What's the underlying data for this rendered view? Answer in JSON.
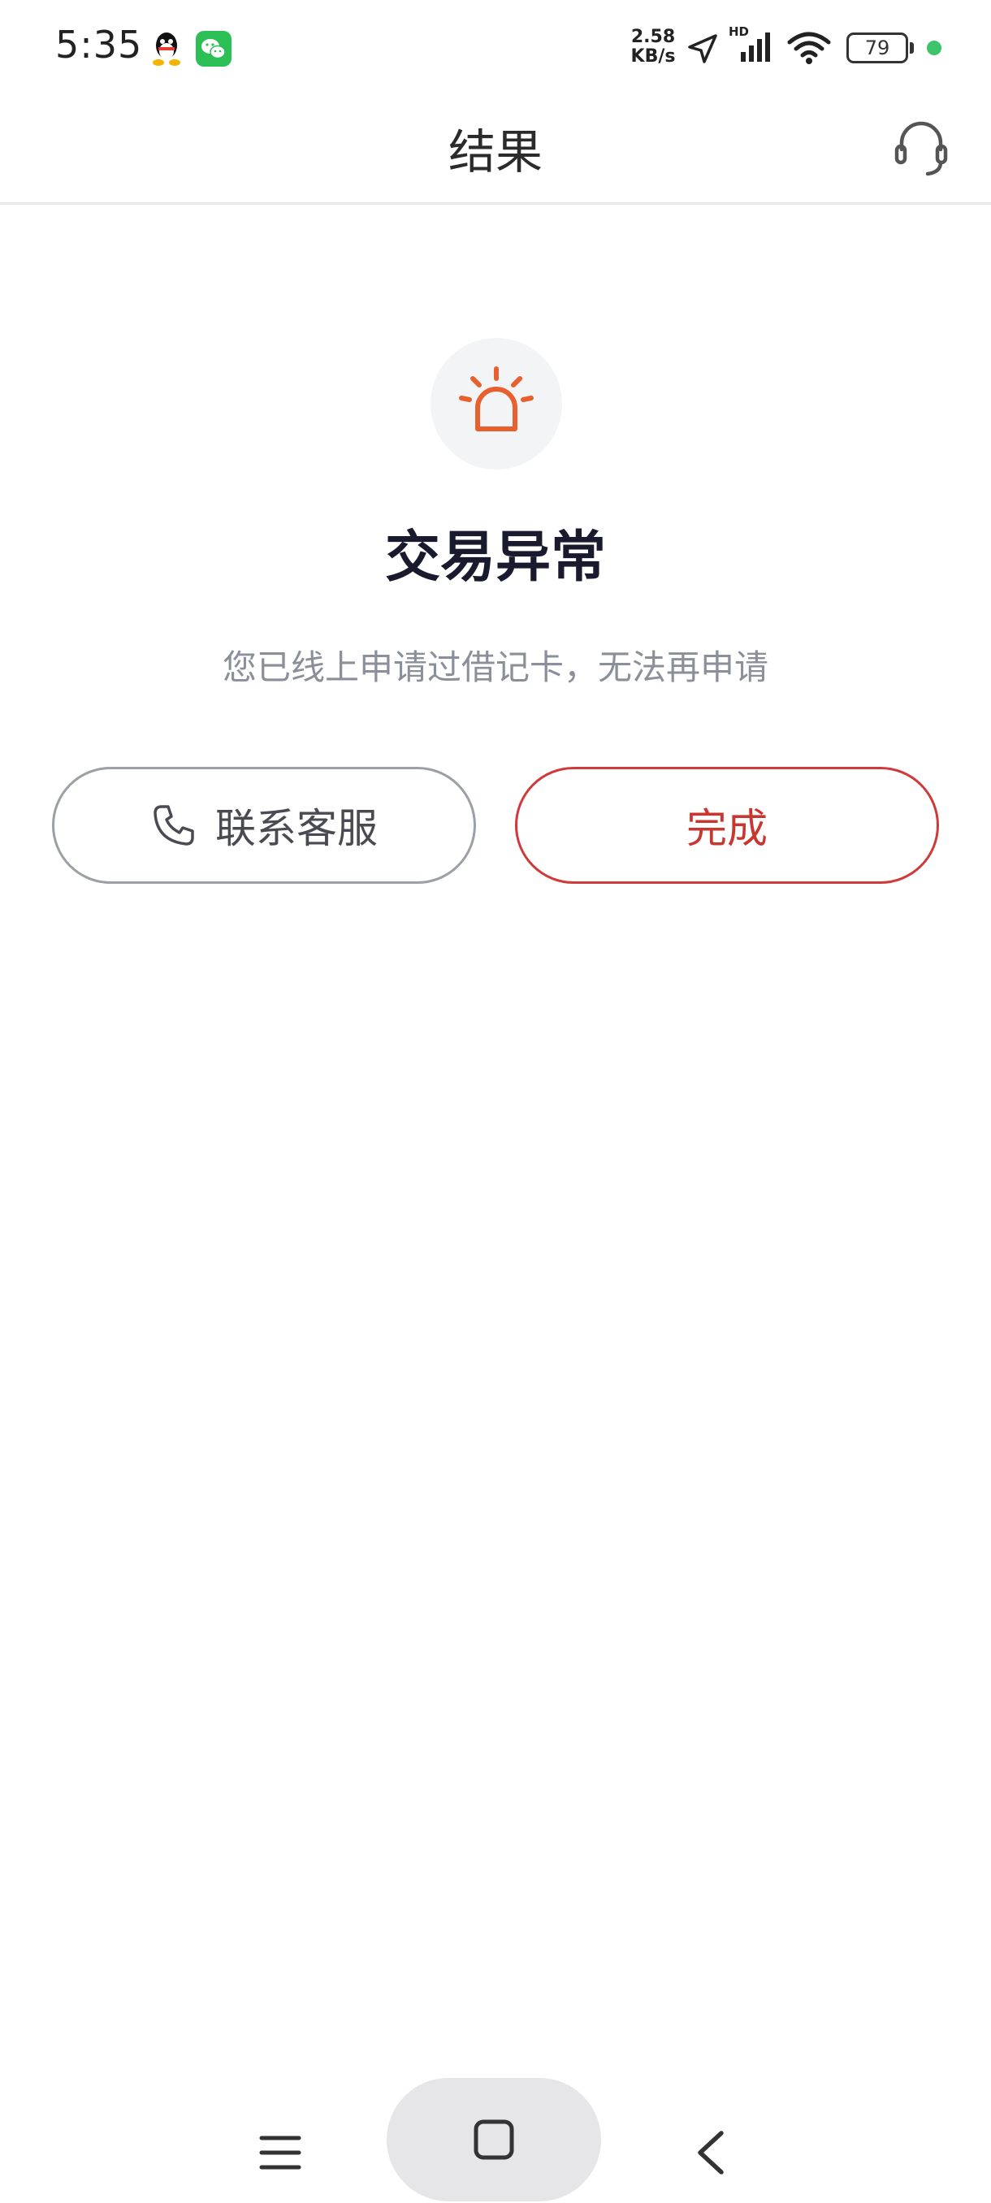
{
  "status_bar": {
    "time": "5:35",
    "net_speed_value": "2.58",
    "net_speed_unit": "KB/s",
    "hd_label": "HD",
    "battery_level": "79"
  },
  "header": {
    "title": "结果"
  },
  "result": {
    "title": "交易异常",
    "message": "您已线上申请过借记卡，无法再申请"
  },
  "buttons": {
    "contact_label": "联系客服",
    "done_label": "完成"
  },
  "colors": {
    "accent_orange": "#e8602d",
    "done_red": "#c8362f",
    "wechat_green": "#2bbf56"
  }
}
